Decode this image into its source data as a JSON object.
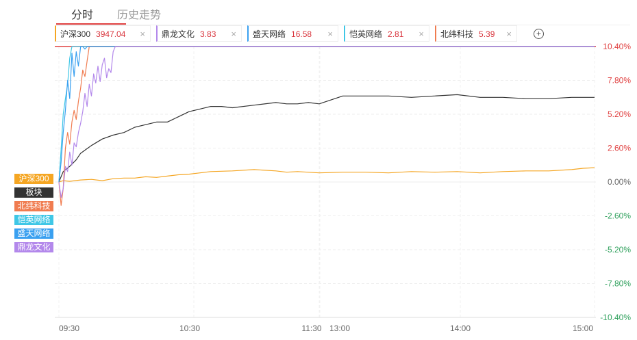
{
  "tabs": {
    "intraday": "分时",
    "history": "历史走势"
  },
  "chips": [
    {
      "name": "沪深300",
      "value": "3947.04",
      "color": "#f5a623"
    },
    {
      "name": "鼎龙文化",
      "value": "3.83",
      "color": "#b388eb"
    },
    {
      "name": "盛天网络",
      "value": "16.58",
      "color": "#3aa0f0"
    },
    {
      "name": "恺英网络",
      "value": "2.81",
      "color": "#3fc7e6"
    },
    {
      "name": "北纬科技",
      "value": "5.39",
      "color": "#f07c50"
    }
  ],
  "close_glyph": "×",
  "add_glyph": "+",
  "legend": [
    {
      "label": "沪深300",
      "color": "#f5a623"
    },
    {
      "label": "板块",
      "color": "#333"
    },
    {
      "label": "北纬科技",
      "color": "#f07c50"
    },
    {
      "label": "恺英网络",
      "color": "#3fc7e6"
    },
    {
      "label": "盛天网络",
      "color": "#3aa0f0"
    },
    {
      "label": "鼎龙文化",
      "color": "#b388eb"
    }
  ],
  "chart_data": {
    "type": "line",
    "ylim": [
      -10.4,
      10.4
    ],
    "yticks": [
      {
        "v": 10.4,
        "label": "10.40%"
      },
      {
        "v": 7.8,
        "label": "7.80%"
      },
      {
        "v": 5.2,
        "label": "5.20%"
      },
      {
        "v": 2.6,
        "label": "2.60%"
      },
      {
        "v": 0,
        "label": "0.00%"
      },
      {
        "v": -2.6,
        "label": "-2.60%"
      },
      {
        "v": -5.2,
        "label": "-5.20%"
      },
      {
        "v": -7.8,
        "label": "-7.80%"
      },
      {
        "v": -10.4,
        "label": "-10.40%"
      }
    ],
    "xticks": [
      "09:30",
      "10:30",
      "11:30",
      "13:00",
      "14:00",
      "15:00"
    ],
    "xlim": [
      0,
      240
    ],
    "limit_up": 10.4,
    "limit_line_color": "#e04040",
    "series": [
      {
        "name": "沪深300",
        "color": "#f5a623",
        "x": [
          0,
          2,
          5,
          10,
          15,
          20,
          25,
          30,
          35,
          40,
          45,
          50,
          55,
          60,
          70,
          80,
          90,
          100,
          105,
          110,
          120,
          130,
          140,
          150,
          160,
          170,
          180,
          190,
          200,
          210,
          220,
          230,
          235,
          240
        ],
        "y": [
          0,
          0.1,
          0.05,
          0.15,
          0.2,
          0.1,
          0.25,
          0.3,
          0.3,
          0.4,
          0.35,
          0.45,
          0.55,
          0.6,
          0.8,
          0.85,
          0.95,
          0.85,
          0.75,
          0.8,
          0.7,
          0.75,
          0.75,
          0.7,
          0.8,
          0.75,
          0.8,
          0.7,
          0.8,
          0.85,
          0.85,
          0.95,
          1.05,
          1.1
        ]
      },
      {
        "name": "板块",
        "color": "#333333",
        "x": [
          0,
          2,
          5,
          8,
          10,
          15,
          20,
          25,
          30,
          35,
          40,
          45,
          50,
          55,
          60,
          65,
          70,
          75,
          80,
          90,
          100,
          105,
          110,
          115,
          120,
          130,
          140,
          150,
          160,
          170,
          180,
          190,
          200,
          210,
          220,
          230,
          240
        ],
        "y": [
          0,
          0.8,
          1.2,
          1.7,
          2.2,
          2.8,
          3.3,
          3.6,
          3.8,
          4.2,
          4.4,
          4.6,
          4.6,
          5.0,
          5.4,
          5.6,
          5.8,
          5.8,
          5.7,
          5.9,
          6.1,
          6.0,
          6.0,
          6.1,
          6.0,
          6.6,
          6.6,
          6.6,
          6.5,
          6.6,
          6.7,
          6.5,
          6.5,
          6.4,
          6.4,
          6.5,
          6.5
        ]
      },
      {
        "name": "北纬科技",
        "color": "#f07c50",
        "x": [
          0,
          1,
          2,
          3,
          4,
          5,
          6,
          7,
          8,
          9,
          10,
          11,
          12,
          13,
          14,
          15,
          240
        ],
        "y": [
          0,
          -1.8,
          -0.5,
          2.6,
          3.8,
          2.9,
          4.6,
          5.5,
          4.8,
          6.2,
          7.2,
          8.6,
          8.1,
          9.3,
          10.4,
          10.4,
          10.4
        ]
      },
      {
        "name": "恺英网络",
        "color": "#3fc7e6",
        "x": [
          0,
          1,
          2,
          3,
          4,
          5,
          6,
          7,
          8,
          9,
          240
        ],
        "y": [
          0,
          2.5,
          5.2,
          6.4,
          7.5,
          9.5,
          10.4,
          10.4,
          10.4,
          10.4,
          10.4
        ]
      },
      {
        "name": "盛天网络",
        "color": "#3aa0f0",
        "x": [
          0,
          1,
          2,
          3,
          4,
          5,
          6,
          7,
          8,
          9,
          10,
          11,
          12,
          13,
          240
        ],
        "y": [
          0,
          1.5,
          3.8,
          5.5,
          7.8,
          6.4,
          9.9,
          8.1,
          10.0,
          8.9,
          10.4,
          10.4,
          10.2,
          10.4,
          10.4
        ]
      },
      {
        "name": "鼎龙文化",
        "color": "#b388eb",
        "x": [
          0,
          1,
          2,
          3,
          4,
          5,
          6,
          7,
          8,
          9,
          10,
          11,
          12,
          13,
          14,
          15,
          16,
          17,
          18,
          19,
          20,
          21,
          22,
          23,
          24,
          25,
          26,
          240
        ],
        "y": [
          0,
          -1.2,
          -0.5,
          1.2,
          0.8,
          2.3,
          1.3,
          3.0,
          2.7,
          3.8,
          4.5,
          5.4,
          6.8,
          5.8,
          7.5,
          6.6,
          8.3,
          7.6,
          8.9,
          7.7,
          9.0,
          9.5,
          8.0,
          8.7,
          8.4,
          10.0,
          10.4,
          10.4
        ]
      }
    ]
  }
}
